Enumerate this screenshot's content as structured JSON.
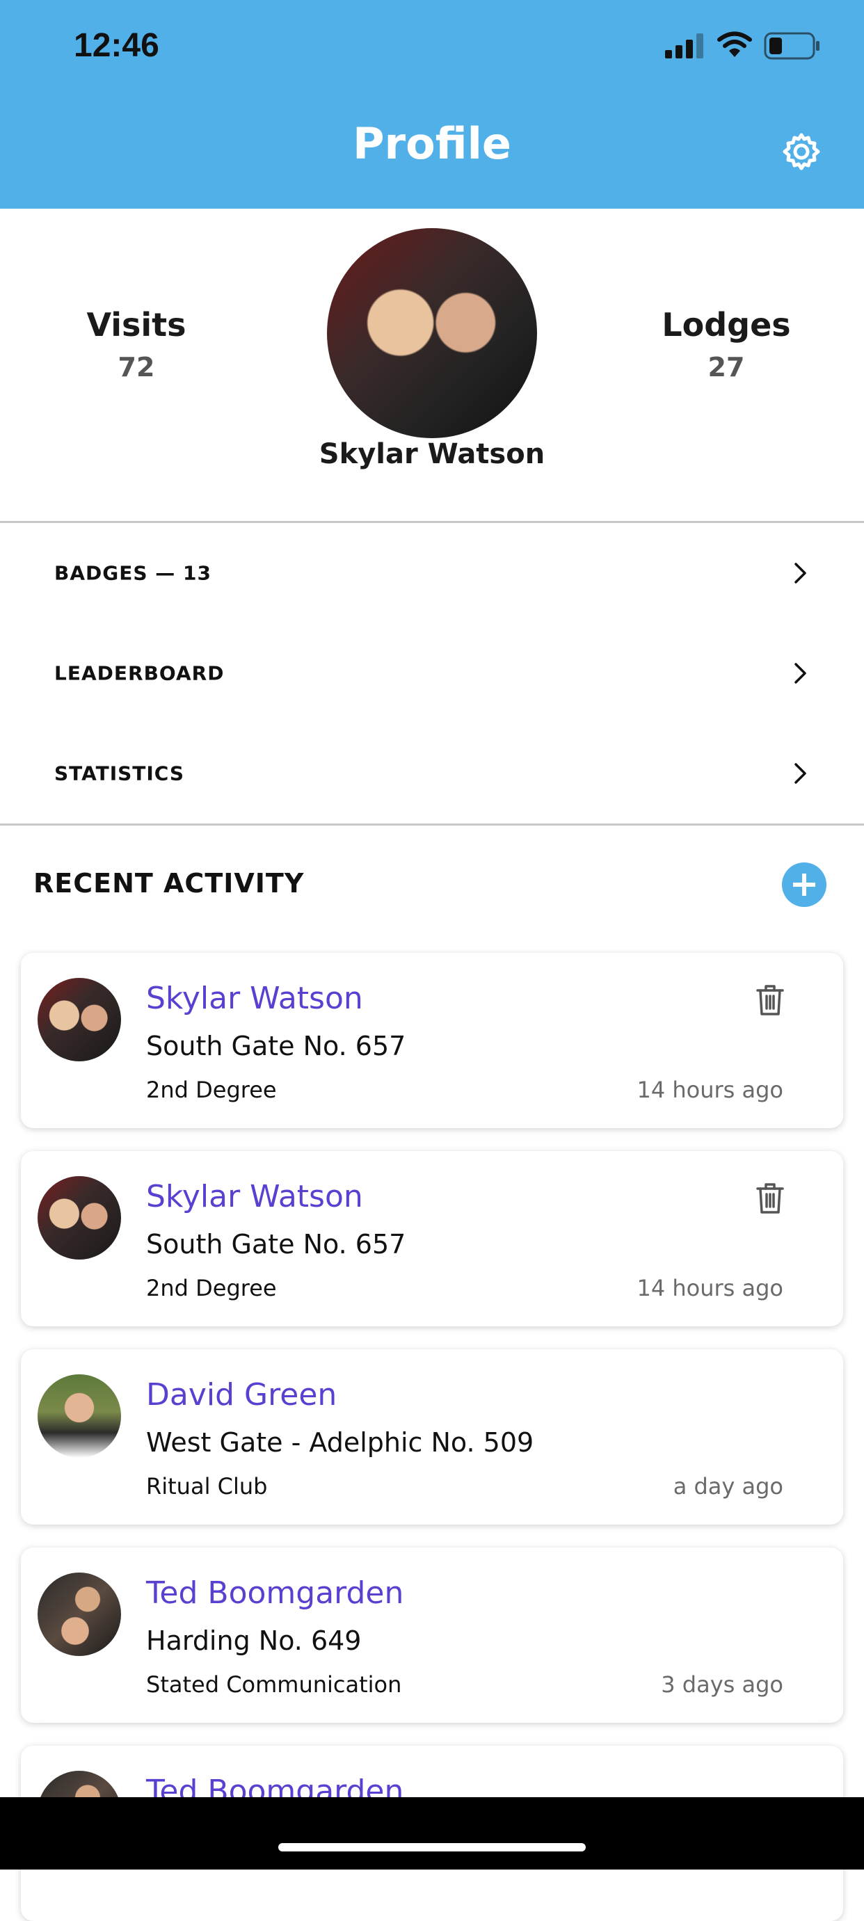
{
  "status_bar": {
    "time": "12:46"
  },
  "header": {
    "title": "Profile",
    "settings_icon": "gear-icon"
  },
  "profile": {
    "visits_label": "Visits",
    "visits_value": "72",
    "lodges_label": "Lodges",
    "lodges_value": "27",
    "name": "Skylar Watson"
  },
  "menu": [
    {
      "label": "BADGES —  13"
    },
    {
      "label": "LEADERBOARD"
    },
    {
      "label": "STATISTICS"
    }
  ],
  "recent_activity": {
    "title": "RECENT ACTIVITY",
    "items": [
      {
        "name": "Skylar Watson",
        "lodge": "South Gate No. 657",
        "type": "2nd Degree",
        "time": "14 hours ago"
      },
      {
        "name": "Skylar Watson",
        "lodge": "South Gate No. 657",
        "type": "2nd Degree",
        "time": "14 hours ago"
      },
      {
        "name": "David Green",
        "lodge": "West Gate - Adelphic No. 509",
        "type": "Ritual Club",
        "time": "a day ago"
      },
      {
        "name": "Ted Boomgarden",
        "lodge": "Harding No. 649",
        "type": "Stated Communication",
        "time": "3 days ago"
      },
      {
        "name": "Ted Boomgarden"
      }
    ]
  },
  "colors": {
    "header": "#52b0e8",
    "accent_name": "#5a3fd0"
  }
}
